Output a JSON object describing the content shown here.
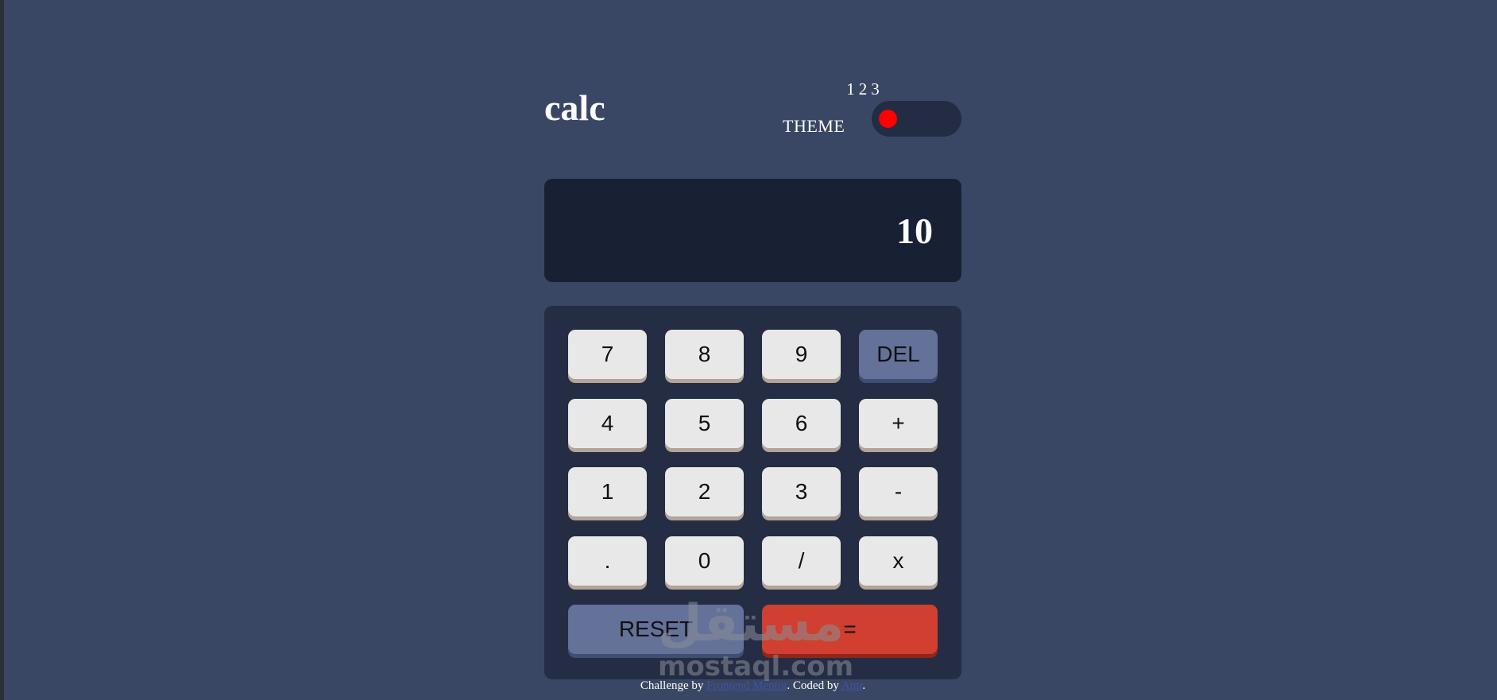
{
  "header": {
    "title": "calc",
    "theme_label": "THEME",
    "theme_options": [
      "1",
      "2",
      "3"
    ],
    "active_theme": 1
  },
  "display": {
    "value": "10"
  },
  "keypad": {
    "keys": [
      {
        "label": "7",
        "variant": "default"
      },
      {
        "label": "8",
        "variant": "default"
      },
      {
        "label": "9",
        "variant": "default"
      },
      {
        "label": "DEL",
        "variant": "blue"
      },
      {
        "label": "4",
        "variant": "default"
      },
      {
        "label": "5",
        "variant": "default"
      },
      {
        "label": "6",
        "variant": "default"
      },
      {
        "label": "+",
        "variant": "default"
      },
      {
        "label": "1",
        "variant": "default"
      },
      {
        "label": "2",
        "variant": "default"
      },
      {
        "label": "3",
        "variant": "default"
      },
      {
        "label": "-",
        "variant": "default"
      },
      {
        "label": ".",
        "variant": "default"
      },
      {
        "label": "0",
        "variant": "default"
      },
      {
        "label": "/",
        "variant": "default"
      },
      {
        "label": "x",
        "variant": "default"
      }
    ],
    "reset_label": "RESET",
    "equals_label": "="
  },
  "footer": {
    "prefix": "Challenge by ",
    "link1": "Frontend Mentor",
    "middle": ". Coded by ",
    "link2": "Amr",
    "suffix": "."
  },
  "watermark": {
    "arabic": "مستقل",
    "latin": "mostaql.com"
  },
  "colors": {
    "background": "#3a4764",
    "screen": "#182034",
    "keypad": "#242d44",
    "key": "#e8e8e8",
    "key_blue": "#647198",
    "key_red": "#d03f2f",
    "toggle_knob": "#ff0000"
  }
}
